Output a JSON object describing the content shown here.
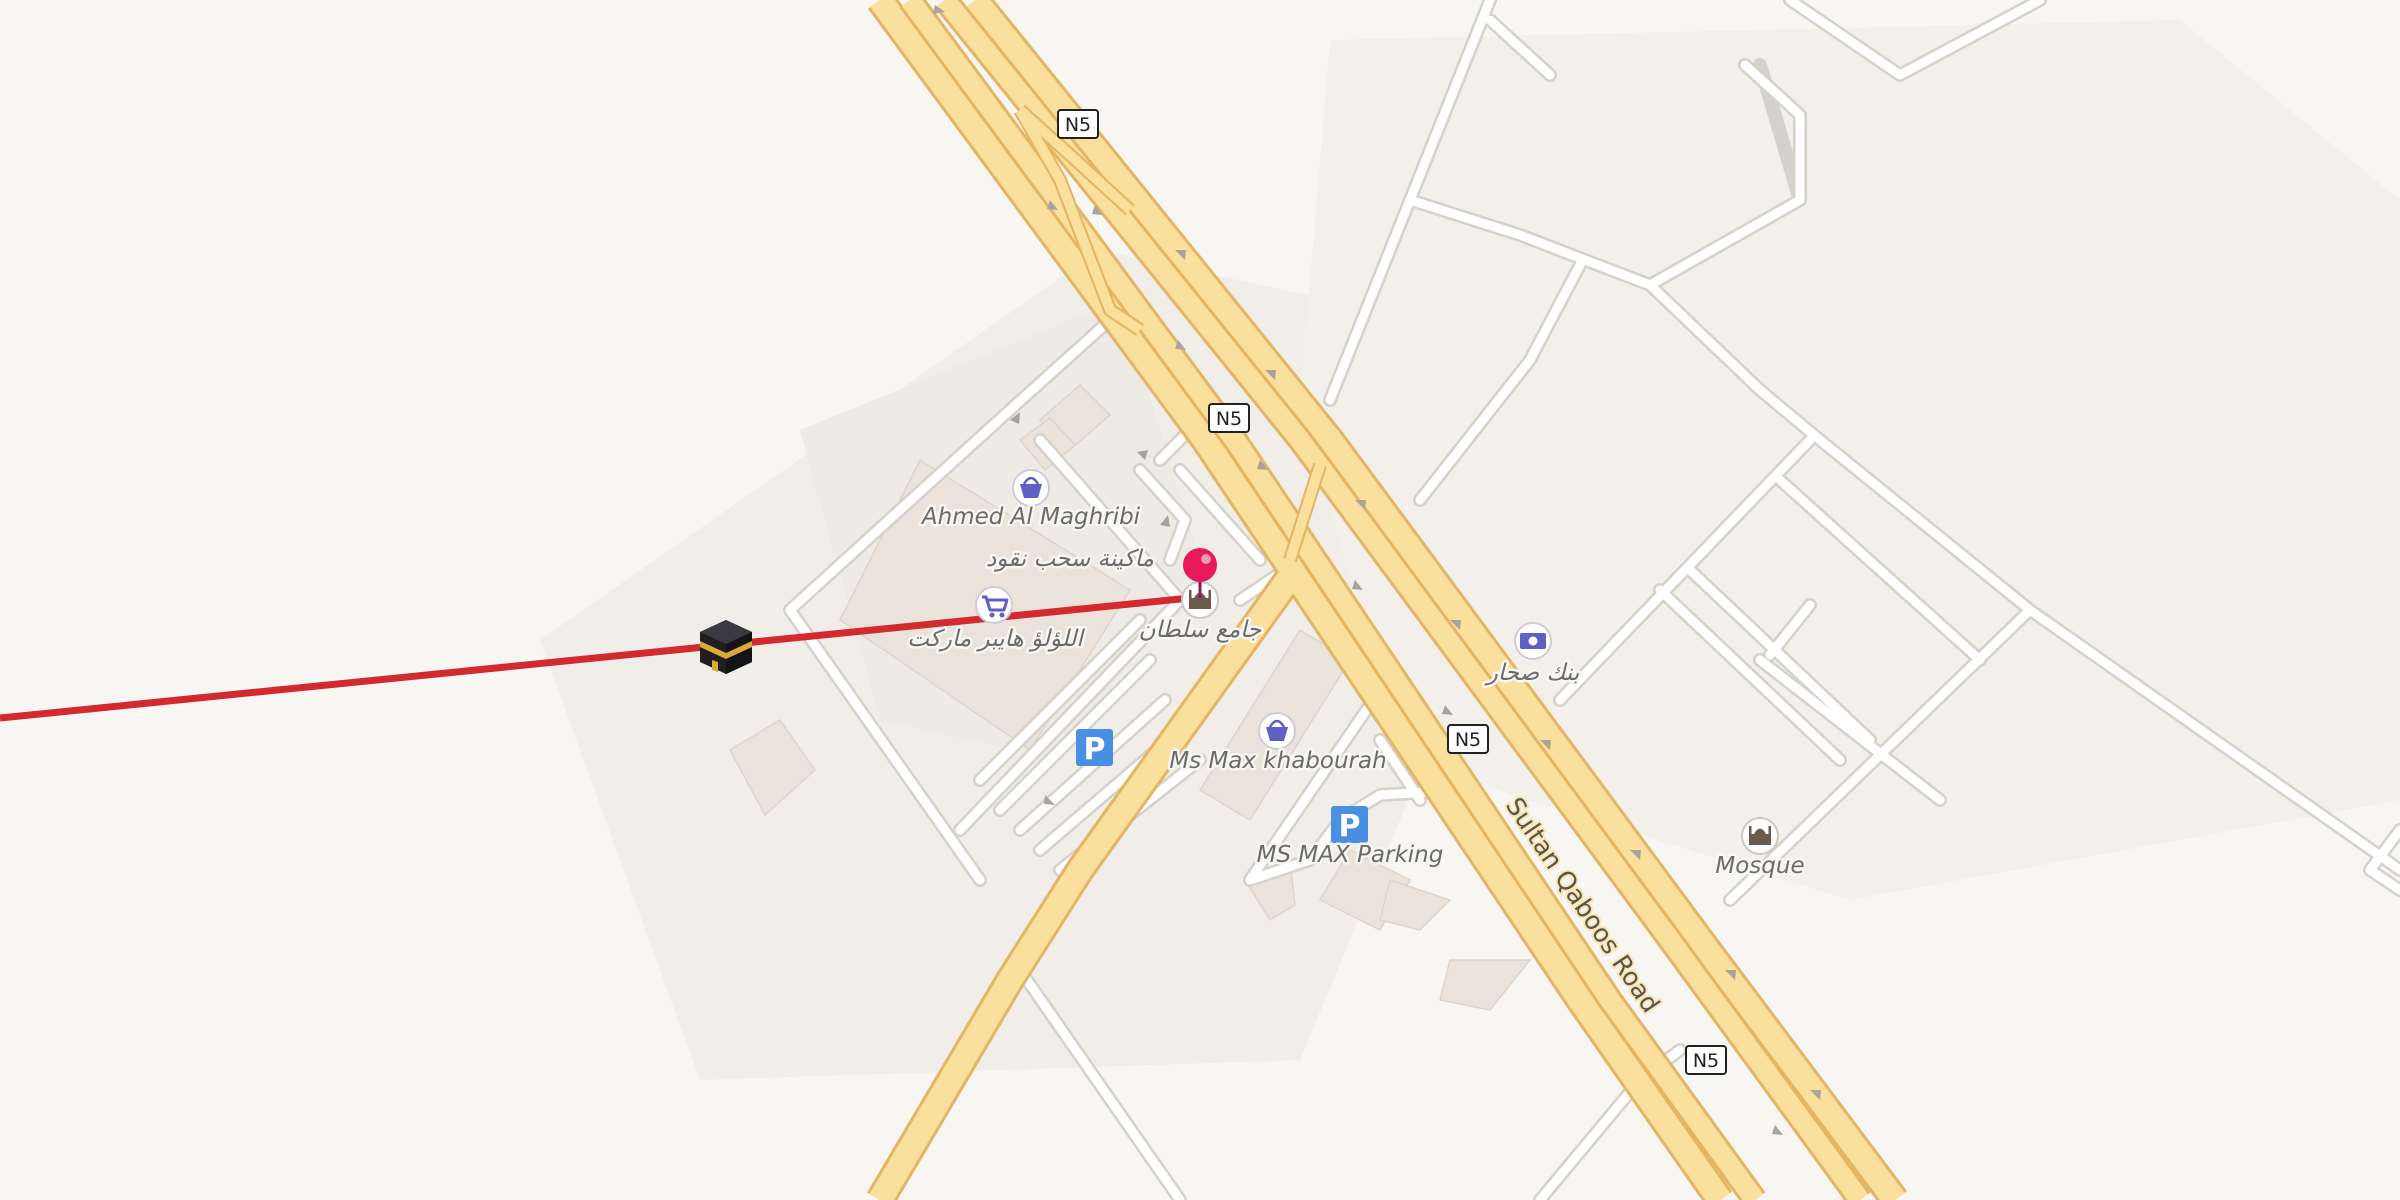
{
  "map": {
    "road_shield": "N5",
    "road_name": "Sultan Qaboos Road",
    "colors": {
      "background": "#f8f6f3",
      "area": "#efebe7",
      "building": "#e7e1da",
      "minor_road": "#ffffff",
      "minor_road_casing": "#d9d6d2",
      "highway": "#fbdc93",
      "highway_casing": "#e6b765",
      "route_line": "#d32a2f",
      "pin": "#e8195c",
      "poi_icon": "#5f5fc4",
      "parking": "#4a90e2"
    },
    "pois": {
      "ahmed": {
        "label": "Ahmed Al Maghribi",
        "icon": "shopping-basket-icon"
      },
      "atm": {
        "label": "ماكينة سحب نقود"
      },
      "lulu": {
        "label": "اللؤلؤ هايبر ماركت",
        "icon": "shopping-cart-icon"
      },
      "mosque_sultan": {
        "label": "جامع سلطان",
        "icon": "mosque-icon"
      },
      "bank": {
        "label": "بنك صحار",
        "icon": "banknote-icon"
      },
      "msmax": {
        "label": "Ms Max khabourah",
        "icon": "shopping-basket-icon"
      },
      "parking_msmax": {
        "label": "MS MAX Parking",
        "icon": "parking-icon"
      },
      "parking_west": {
        "icon": "parking-icon"
      },
      "mosque": {
        "label": "Mosque",
        "icon": "mosque-icon"
      }
    },
    "parking_glyph": "P",
    "markers": {
      "pin": "location-pin-icon",
      "kaaba": "kaaba-icon",
      "qibla_line": "qibla-direction-line"
    }
  }
}
